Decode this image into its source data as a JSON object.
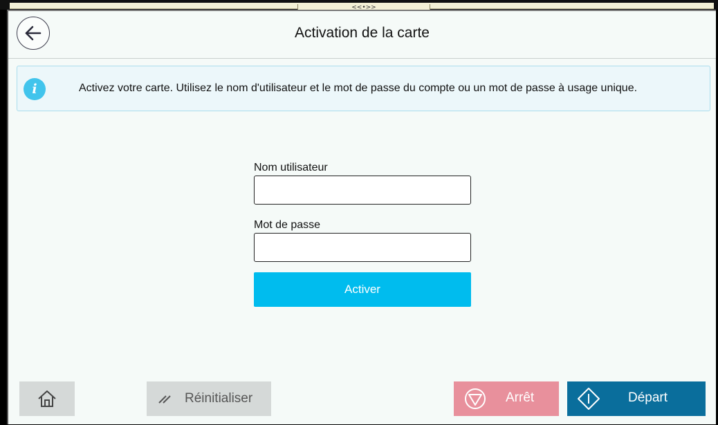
{
  "top_handle": {
    "label": "<<•>>"
  },
  "header": {
    "title": "Activation de la carte",
    "back_icon": "arrow-left-icon"
  },
  "info": {
    "icon": "info-icon",
    "icon_glyph": "i",
    "message": "Activez votre carte. Utilisez le nom d'utilisateur et le mot de passe du compte ou un mot de passe à usage unique."
  },
  "form": {
    "username_label": "Nom utilisateur",
    "username_value": "",
    "password_label": "Mot de passe",
    "password_value": "",
    "activate_label": "Activer"
  },
  "bottom_bar": {
    "home_icon": "home-icon",
    "reset_label": "Réinitialiser",
    "reset_icon": "reset-slash-icon",
    "stop_label": "Arrêt",
    "stop_icon": "stop-icon",
    "start_label": "Départ",
    "start_icon": "start-icon"
  },
  "colors": {
    "accent": "#00bcee",
    "start": "#0a6e9c",
    "stop": "#e8909c",
    "info_icon": "#41c4ec"
  }
}
